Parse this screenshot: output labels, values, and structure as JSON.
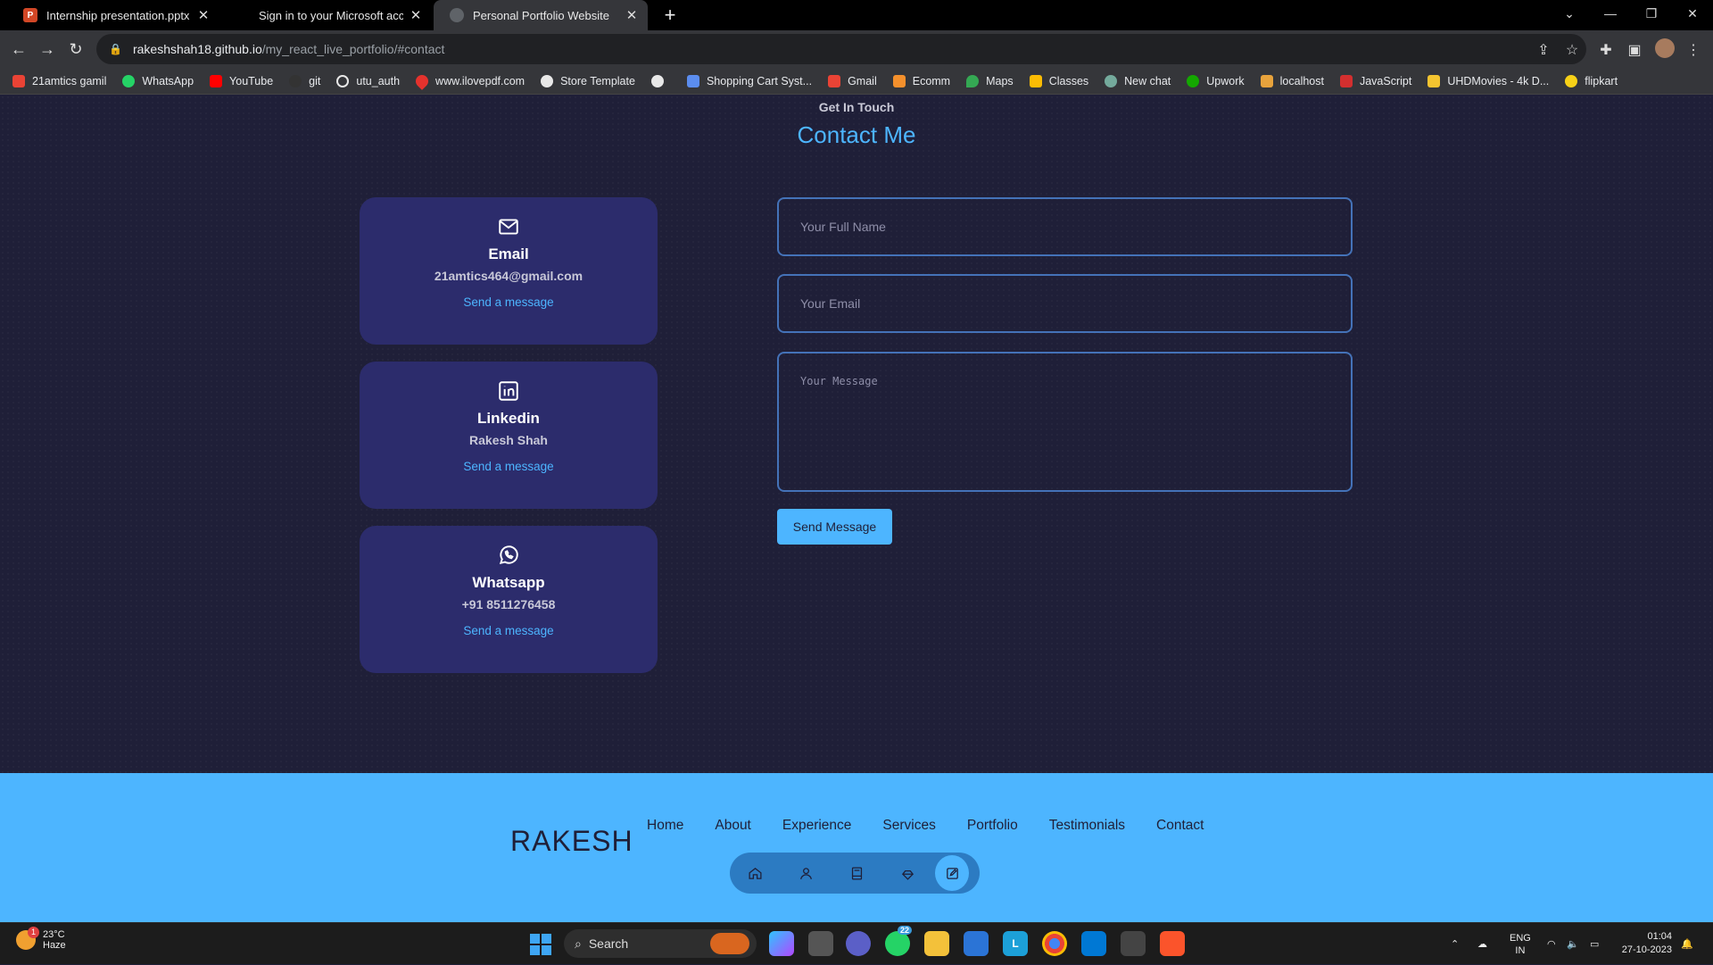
{
  "browser": {
    "tabs": [
      {
        "title": "Internship presentation.pptx - M",
        "favicon_color": "#d24726",
        "favicon_letter": "P",
        "active": false
      },
      {
        "title": "Sign in to your Microsoft accour",
        "favicon_color": "#0078d4",
        "favicon_letter": "",
        "active": false
      },
      {
        "title": "Personal Portfolio Website",
        "favicon_color": "#5f6368",
        "favicon_letter": "",
        "active": true
      }
    ],
    "url_host": "rakeshshah18.github.io",
    "url_path": "/my_react_live_portfolio/#contact",
    "bookmarks": [
      {
        "label": "21amtics gamil",
        "color": "#ea4335"
      },
      {
        "label": "WhatsApp",
        "color": "#25d366"
      },
      {
        "label": "YouTube",
        "color": "#ff0000"
      },
      {
        "label": "git",
        "color": "#333333"
      },
      {
        "label": "utu_auth",
        "color": "#e8e8e8"
      },
      {
        "label": "www.ilovepdf.com",
        "color": "#e5322d"
      },
      {
        "label": "Store Template",
        "color": "#e8e8e8"
      },
      {
        "label": "",
        "color": "#e8e8e8"
      },
      {
        "label": "Shopping Cart Syst...",
        "color": "#5b8def"
      },
      {
        "label": "Gmail",
        "color": "#ea4335"
      },
      {
        "label": "Ecomm",
        "color": "#f4902c"
      },
      {
        "label": "Maps",
        "color": "#34a853"
      },
      {
        "label": "Classes",
        "color": "#fbbc04"
      },
      {
        "label": "New chat",
        "color": "#74aa9c"
      },
      {
        "label": "Upwork",
        "color": "#14a800"
      },
      {
        "label": "localhost",
        "color": "#e8a33c"
      },
      {
        "label": "JavaScript",
        "color": "#d32f2f"
      },
      {
        "label": "UHDMovies - 4k D...",
        "color": "#f4c430"
      },
      {
        "label": "flipkart",
        "color": "#f7d117"
      }
    ]
  },
  "contact": {
    "subtitle": "Get In Touch",
    "title": "Contact Me",
    "cards": [
      {
        "icon": "mail-icon",
        "name": "Email",
        "value": "21amtics464@gmail.com",
        "link": "Send a message"
      },
      {
        "icon": "linkedin-icon",
        "name": "Linkedin",
        "value": "Rakesh Shah",
        "link": "Send a message"
      },
      {
        "icon": "whatsapp-icon",
        "name": "Whatsapp",
        "value": "+91 8511276458",
        "link": "Send a message"
      }
    ],
    "form": {
      "name_placeholder": "Your Full Name",
      "email_placeholder": "Your Email",
      "message_placeholder": "Your Message",
      "submit_label": "Send Message"
    }
  },
  "footer": {
    "logo": "RAKESH",
    "links": [
      "Home",
      "About",
      "Experience",
      "Services",
      "Portfolio",
      "Testimonials",
      "Contact"
    ],
    "pill_icons": [
      "home-icon",
      "user-icon",
      "book-icon",
      "services-icon",
      "message-icon"
    ],
    "active_pill": "message-icon"
  },
  "taskbar": {
    "weather_temp": "23°C",
    "weather_desc": "Haze",
    "weather_badge": "1",
    "search_label": "Search",
    "lang_line1": "ENG",
    "lang_line2": "IN",
    "time": "01:04",
    "date": "27-10-2023",
    "whatsapp_badge": "22"
  },
  "colors": {
    "page_bg": "#1f1f38",
    "card_bg": "#2c2c6c",
    "accent": "#4db5ff"
  }
}
